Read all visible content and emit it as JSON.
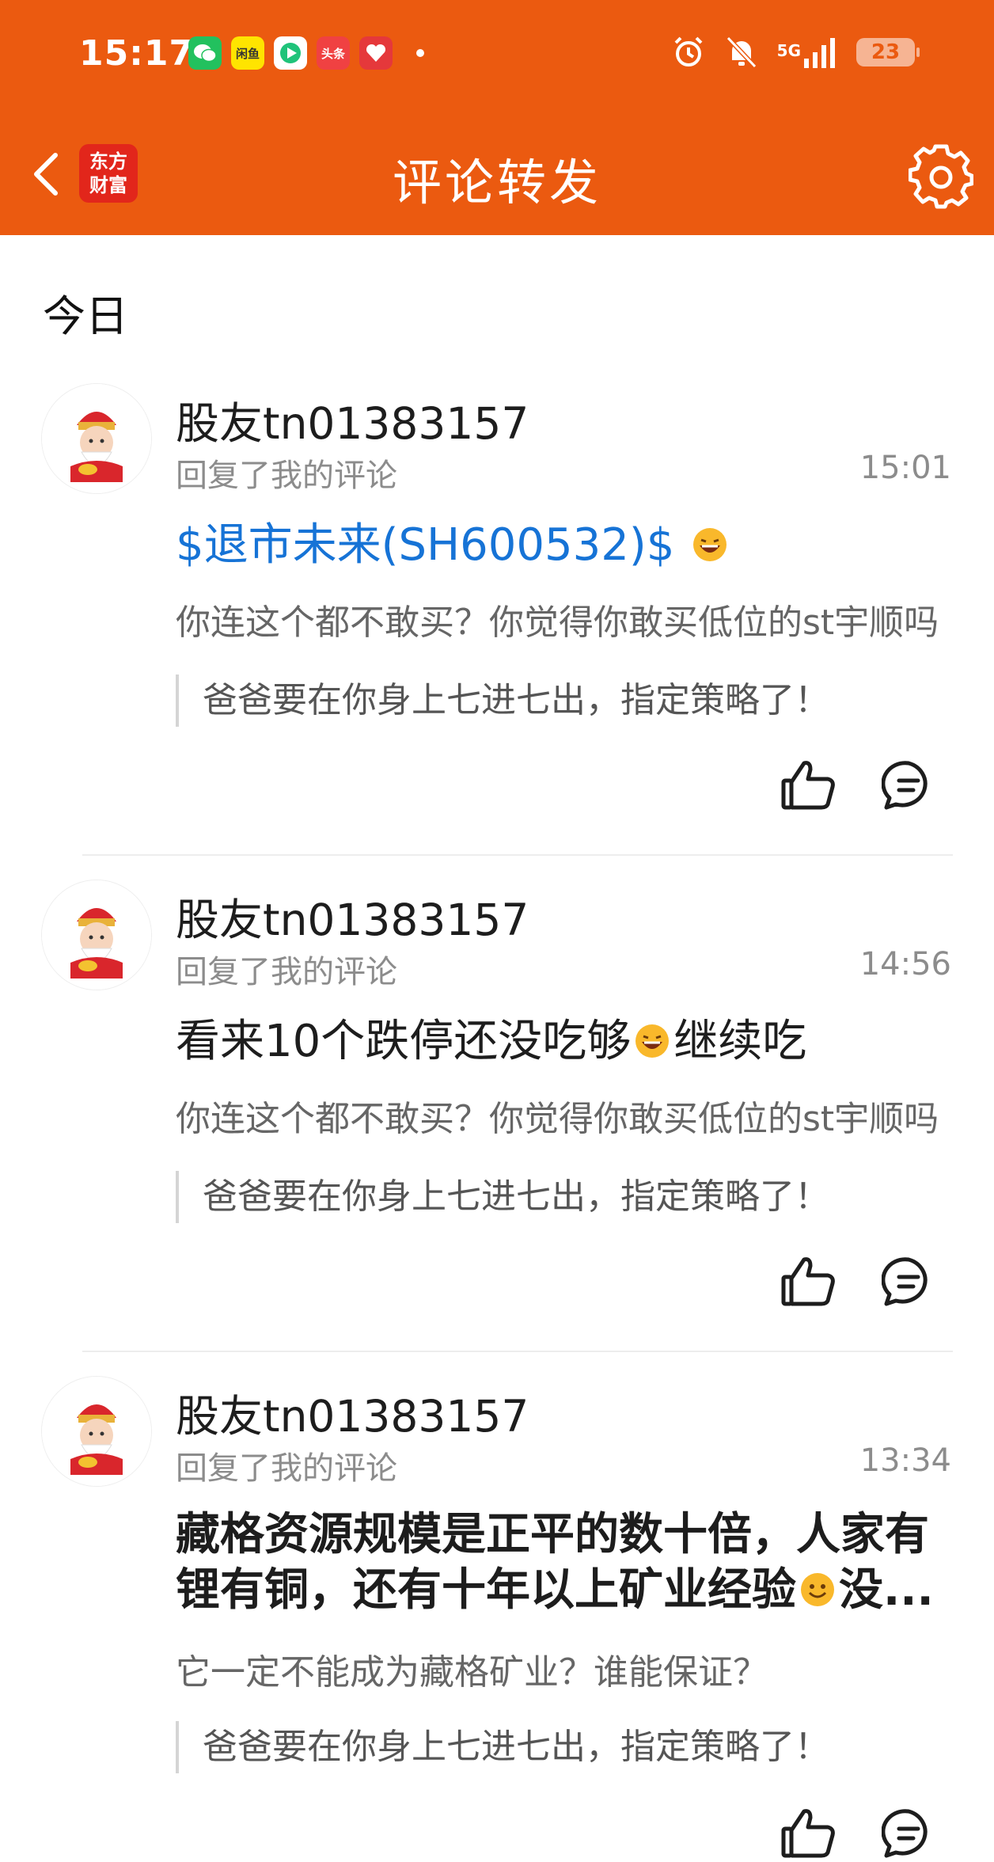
{
  "status_bar": {
    "time": "15:17",
    "apps": [
      {
        "name": "wechat-icon",
        "label": "",
        "bg": "#22C15E",
        "fg": "#fff"
      },
      {
        "name": "xianyu-icon",
        "label": "闲鱼",
        "bg": "#FFE400",
        "fg": "#333"
      },
      {
        "name": "video-app-icon",
        "label": "",
        "bg": "#ffffff",
        "fg": "#1aa1e6"
      },
      {
        "name": "toutiao-icon",
        "label": "头条",
        "bg": "#F04142",
        "fg": "#fff"
      },
      {
        "name": "shopping-app-icon",
        "label": "",
        "bg": "#E5383B",
        "fg": "#fff"
      }
    ],
    "network": "5G",
    "battery": "23"
  },
  "header": {
    "logo_line1": "东方",
    "logo_line2": "财富",
    "title": "评论转发",
    "accent_color": "#EB5A10"
  },
  "section_title": "今日",
  "items": [
    {
      "username": "股友tn01383157",
      "subtitle": "回复了我的评论",
      "time": "15:01",
      "content_pre": "$退市未来(SH600532)$",
      "content_post": "",
      "original": "你连这个都不敢买？你觉得你敢买低位的st宇顺吗",
      "quote": "爸爸要在你身上七进七出，指定策略了！"
    },
    {
      "username": "股友tn01383157",
      "subtitle": "回复了我的评论",
      "time": "14:56",
      "content_pre": "看来10个跌停还没吃够",
      "content_post": "继续吃",
      "original": "你连这个都不敢买？你觉得你敢买低位的st宇顺吗",
      "quote": "爸爸要在你身上七进七出，指定策略了！"
    },
    {
      "username": "股友tn01383157",
      "subtitle": "回复了我的评论",
      "time": "13:34",
      "content_pre": "藏格资源规模是正平的数十倍，人家有锂有铜，还有十年以上矿业经验",
      "content_post": "没...",
      "original": "它一定不能成为藏格矿业？谁能保证？",
      "quote": "爸爸要在你身上七进七出，指定策略了！"
    }
  ]
}
